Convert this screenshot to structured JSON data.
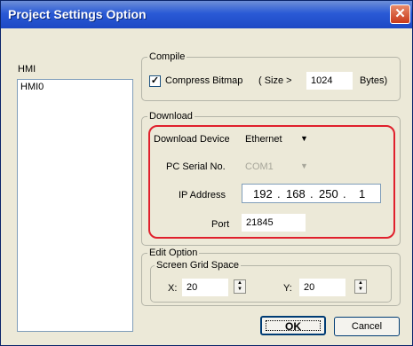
{
  "window": {
    "title": "Project Settings Option",
    "close_glyph": "✕"
  },
  "hmi": {
    "label": "HMI",
    "items": [
      "HMI0"
    ]
  },
  "compile": {
    "group_label": "Compile",
    "compress_label": "Compress Bitmap",
    "compress_checked": true,
    "check_glyph": "✓",
    "size_prefix": "( Size >",
    "size_value": "1024",
    "size_suffix": "Bytes)"
  },
  "download": {
    "group_label": "Download",
    "device_label": "Download Device",
    "device_value": "Ethernet",
    "serial_label": "PC Serial No.",
    "serial_value": "COM1",
    "ip_label": "IP Address",
    "ip": [
      "192",
      "168",
      "250",
      "1"
    ],
    "ip_separator": ".",
    "port_label": "Port",
    "port_value": "21845"
  },
  "edit_option": {
    "group_label": "Edit Option",
    "grid_label": "Screen Grid Space",
    "x_label": "X:",
    "x_value": "20",
    "y_label": "Y:",
    "y_value": "20"
  },
  "buttons": {
    "ok": "OK",
    "cancel": "Cancel"
  },
  "colors": {
    "title_bar": "#2a5ad6",
    "highlight": "#e0202c",
    "dialog_bg": "#ece9d8"
  },
  "icons": {
    "dropdown": "▼",
    "spin_up": "▲",
    "spin_down": "▼"
  }
}
